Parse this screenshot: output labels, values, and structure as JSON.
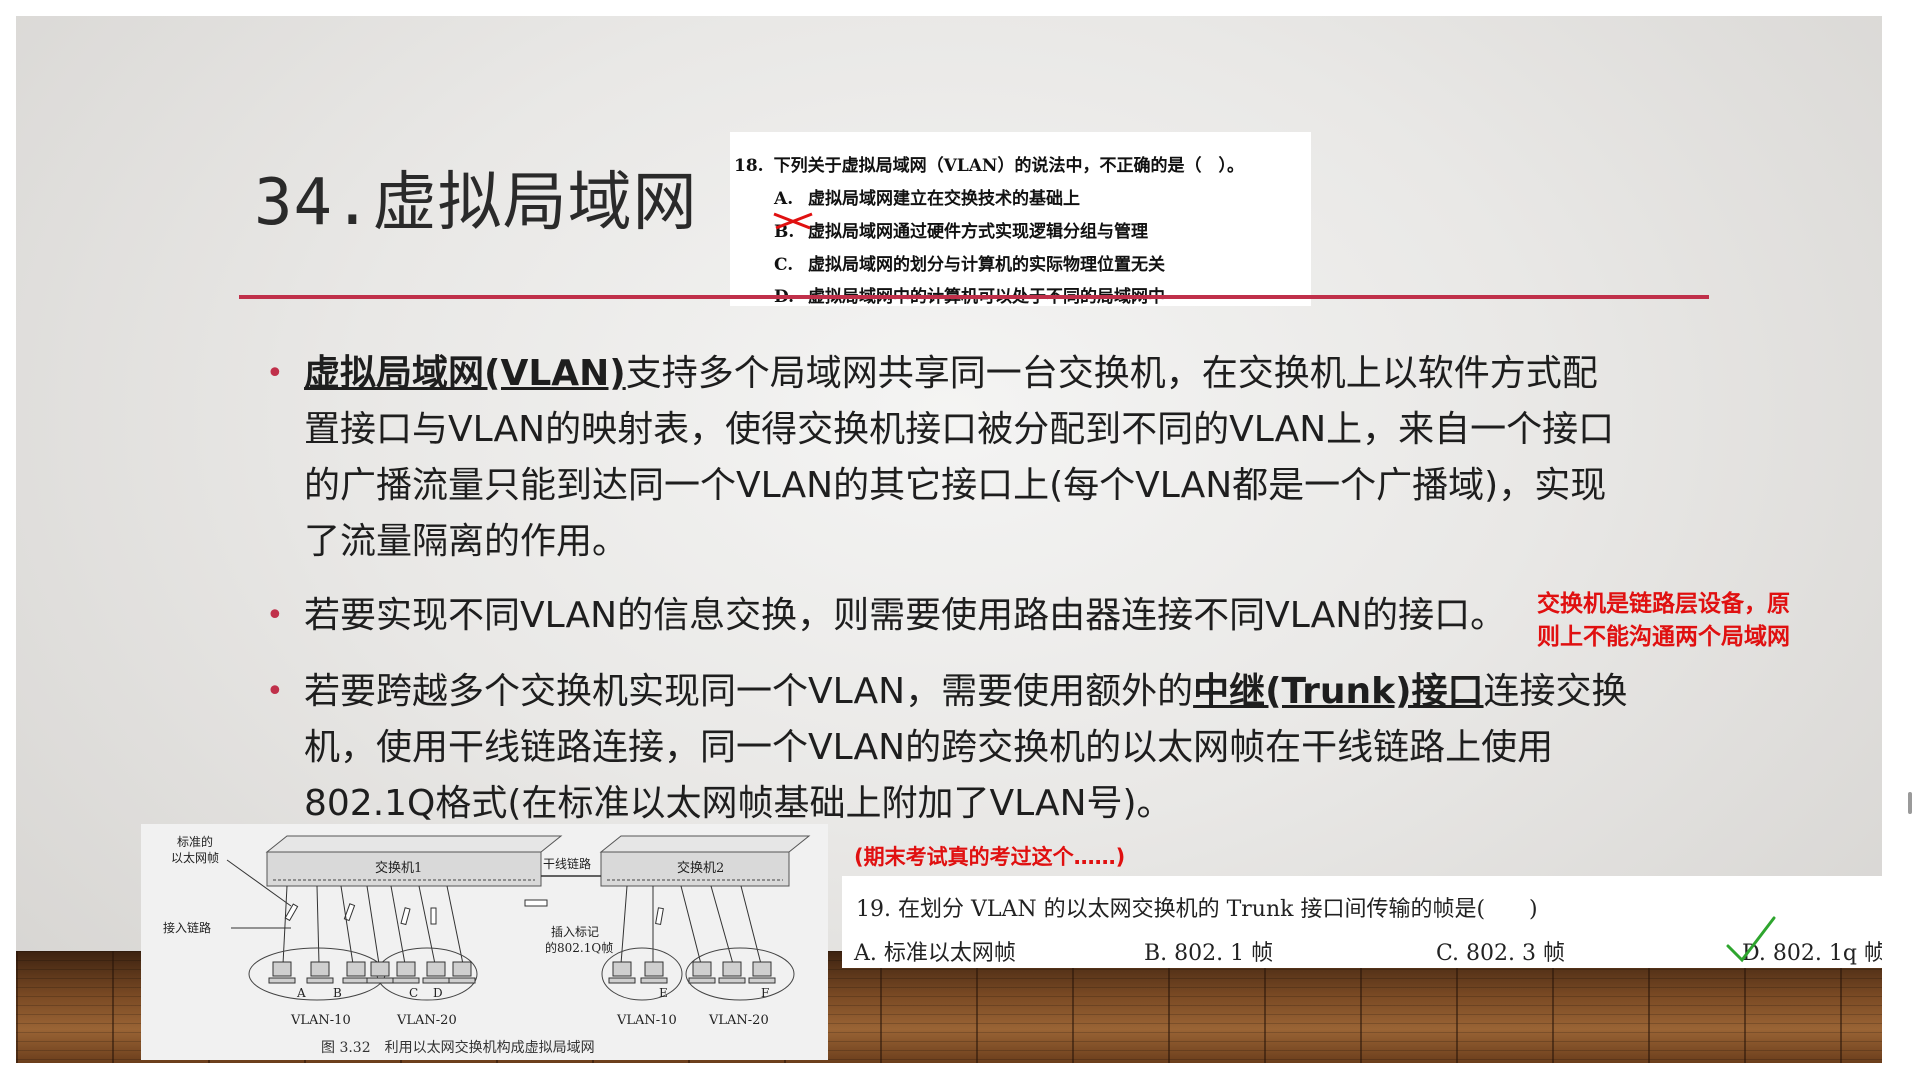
{
  "title": "34.虚拟局域网",
  "question18": {
    "number": "18.",
    "text": "下列关于虚拟局域网（VLAN）的说法中，不正确的是（　）。",
    "options": [
      {
        "label": "A.",
        "text": "虚拟局域网建立在交换技术的基础上"
      },
      {
        "label": "B.",
        "text": "虚拟局域网通过硬件方式实现逻辑分组与管理"
      },
      {
        "label": "C.",
        "text": "虚拟局域网的划分与计算机的实际物理位置无关"
      },
      {
        "label": "D.",
        "text": "虚拟局域网中的计算机可以处于不同的局域网中"
      }
    ]
  },
  "bullets": {
    "b1": {
      "term": "虚拟局域网(VLAN)",
      "line1_rest": "支持多个局域网共享同一台交换机，在交换机上以软件方式配",
      "line2": "置接口与VLAN的映射表，使得交换机接口被分配到不同的VLAN上，来自一个接口",
      "line3": "的广播流量只能到达同一个VLAN的其它接口上(每个VLAN都是一个广播域)，实现",
      "line4": "了流量隔离的作用。"
    },
    "b2": {
      "text": "若要实现不同VLAN的信息交换，则需要使用路由器连接不同VLAN的接口。"
    },
    "b3": {
      "pre": "若要跨越多个交换机实现同一个VLAN，需要使用额外的",
      "term": "中继(Trunk)接口",
      "post": "连接交换",
      "line2": "机，使用干线链路连接，同一个VLAN的跨交换机的以太网帧在干线链路上使用",
      "line3": "802.1Q格式(在标准以太网帧基础上附加了VLAN号)。"
    }
  },
  "side_note": {
    "line1": "交换机是链路层设备，原",
    "line2": "则上不能沟通两个局域网"
  },
  "diagram": {
    "label_std_frame_1": "标准的",
    "label_std_frame_2": "以太网帧",
    "label_access_link": "接入链路",
    "switch1": "交换机1",
    "switch2": "交换机2",
    "trunk_link": "干线链路",
    "insert_tag_1": "插入标记",
    "insert_tag_2": "的802.1Q帧",
    "hosts": [
      "A",
      "B",
      "C",
      "D",
      "E",
      "F"
    ],
    "vlans": [
      "VLAN-10",
      "VLAN-20",
      "VLAN-10",
      "VLAN-20"
    ],
    "caption": "图 3.32　利用以太网交换机构成虚拟局域网"
  },
  "exam_note": "(期末考试真的考过这个……)",
  "question19": {
    "text": "19. 在划分 VLAN 的以太网交换机的 Trunk 接口间传输的帧是(　　)",
    "options": [
      "A. 标准以太网帧",
      "B. 802. 1 帧",
      "C. 802. 3 帧",
      "D. 802. 1q 帧"
    ]
  },
  "colors": {
    "accent": "#c0304a",
    "note_red": "#e01010",
    "check_green": "#2ea52e"
  }
}
